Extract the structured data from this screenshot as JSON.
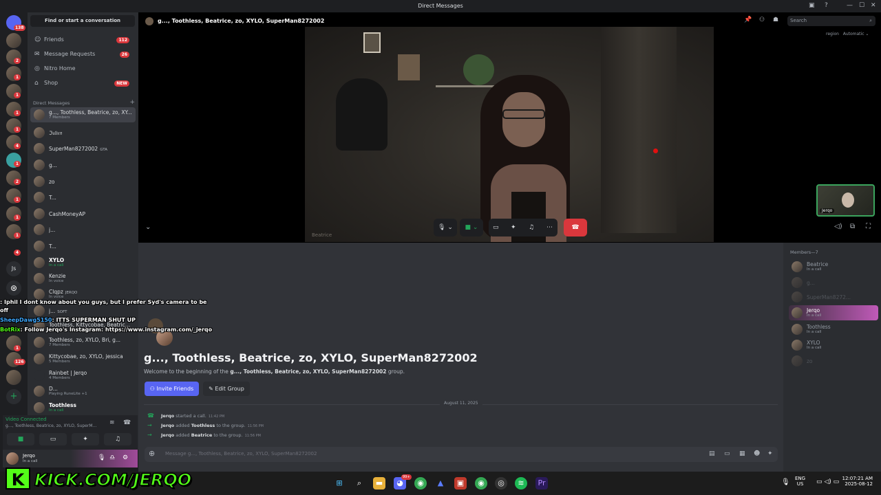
{
  "window": {
    "title": "Direct Messages"
  },
  "guilds": {
    "badges": [
      "138",
      "2",
      "1",
      "1",
      "1",
      "1",
      "4",
      "1",
      "2",
      "1",
      "1",
      "1",
      "4",
      "1",
      "126"
    ],
    "js_label": "Js",
    "add_icon": "plus-icon"
  },
  "sidebar": {
    "find_placeholder": "Find or start a conversation",
    "nav": [
      {
        "label": "Friends",
        "badge": "112",
        "icon": "friends-icon"
      },
      {
        "label": "Message Requests",
        "badge": "26",
        "icon": "envelope-icon"
      },
      {
        "label": "Nitro Home",
        "badge": "",
        "icon": "nitro-icon"
      },
      {
        "label": "Shop",
        "badge": "NEW",
        "icon": "shop-icon"
      }
    ],
    "dm_header": "Direct Messages",
    "dms": [
      {
        "name": "g..., Toothless, Beatrice, zo, XY...",
        "sub": "7 Members",
        "tag": ""
      },
      {
        "name": "ℑ𝔲𝔩𝔦𝔢𝔫",
        "sub": "",
        "tag": ""
      },
      {
        "name": "SuperMan8272002",
        "sub": "",
        "tag": "GTA"
      },
      {
        "name": "g...",
        "sub": "",
        "tag": ""
      },
      {
        "name": "zo",
        "sub": "",
        "tag": ""
      },
      {
        "name": "T...",
        "sub": "",
        "tag": ""
      },
      {
        "name": "CashMoneyAP",
        "sub": "",
        "tag": ""
      },
      {
        "name": "j...",
        "sub": "",
        "tag": ""
      },
      {
        "name": "T...",
        "sub": "",
        "tag": ""
      },
      {
        "name": "XYLO",
        "sub": "In a call",
        "tag": ""
      },
      {
        "name": "Kenzie",
        "sub": "In voice",
        "tag": ""
      },
      {
        "name": "Clqpz",
        "sub": "In voice",
        "tag": "JERQO"
      },
      {
        "name": "j...",
        "sub": "",
        "tag": "SOFT"
      },
      {
        "name": "Toothless, Kittycobae, Beatric...",
        "sub": "",
        "tag": ""
      },
      {
        "name": "Toothless, zo, XYLO, Bri, g...",
        "sub": "7 Members",
        "tag": ""
      },
      {
        "name": "Kittycobae, zo, XYLO, jessica",
        "sub": "5 Members",
        "tag": ""
      },
      {
        "name": "Rainbet | Jerqo",
        "sub": "4 Members",
        "tag": ""
      },
      {
        "name": "D...",
        "sub": "Playing RuneLite +1",
        "tag": ""
      },
      {
        "name": "Toothless",
        "sub": "In a call",
        "tag": ""
      }
    ]
  },
  "voice": {
    "status": "Video Connected",
    "channel": "g..., Toothless, Beatrice, zo, XYLO, SuperM..."
  },
  "user": {
    "name": "Jerqo",
    "status": "In a call"
  },
  "call": {
    "header_name": "g..., Toothless, Beatrice, zo, XYLO, SuperMan8272002",
    "video_label": "Beatrice",
    "self_label": "Jerqo",
    "search_placeholder": "Search",
    "region_label": "region",
    "region_value": "Automatic"
  },
  "chat": {
    "group_title": "g..., Toothless, Beatrice, zo, XYLO, SuperMan8272002",
    "welcome_prefix": "Welcome to the beginning of the",
    "welcome_group": "g..., Toothless, Beatrice, zo, XYLO, SuperMan8272002",
    "welcome_suffix": "group.",
    "invite_label": "Invite Friends",
    "edit_label": "Edit Group",
    "date": "August 11, 2025",
    "log": [
      {
        "actor": "Jerqo",
        "text": "started a call.",
        "target": "",
        "end": "",
        "time": "11:42 PM"
      },
      {
        "actor": "Jerqo",
        "text": "added",
        "target": "Toothless",
        "end": "to the group.",
        "time": "11:56 PM"
      },
      {
        "actor": "Jerqo",
        "text": "added",
        "target": "Beatrice",
        "end": "to the group.",
        "time": "11:56 PM"
      }
    ],
    "composer_placeholder": "Message g..., Toothless, Beatrice, zo, XYLO, SuperMan8272002"
  },
  "members": {
    "header": "Members—7",
    "list": [
      {
        "name": "Beatrice",
        "sub": "In a call"
      },
      {
        "name": "g...",
        "sub": ""
      },
      {
        "name": "SuperMan8272...",
        "sub": ""
      },
      {
        "name": "Jerqo",
        "sub": "In a call"
      },
      {
        "name": "Toothless",
        "sub": "In a call"
      },
      {
        "name": "XYLO",
        "sub": "In a call"
      },
      {
        "name": "zo",
        "sub": ""
      }
    ]
  },
  "stream_overlay": {
    "chat": [
      {
        "user": "",
        "msg": ": Iphil I dont know about you guys, but I prefer Syd's camera to be"
      },
      {
        "user": "",
        "msg": "off"
      },
      {
        "user": "SheepDawg5150",
        "msg": ": ITTS SUPERMAN SHUT UP"
      },
      {
        "user": "BotRix",
        "msg": ": Follow Jerqo's Instagram: https://www.instagram.com/_jerqo"
      }
    ],
    "kick_text": "KICK.COM/JERQO",
    "kick_letter": "K"
  },
  "taskbar": {
    "lang": "ENG",
    "region": "US",
    "time": "12:07:21 AM",
    "date": "2025-08-12",
    "discord_badge": "99+"
  },
  "colors": {
    "accent": "#5865f2",
    "danger": "#da373c",
    "online": "#23a55a",
    "kick": "#53fc18"
  }
}
